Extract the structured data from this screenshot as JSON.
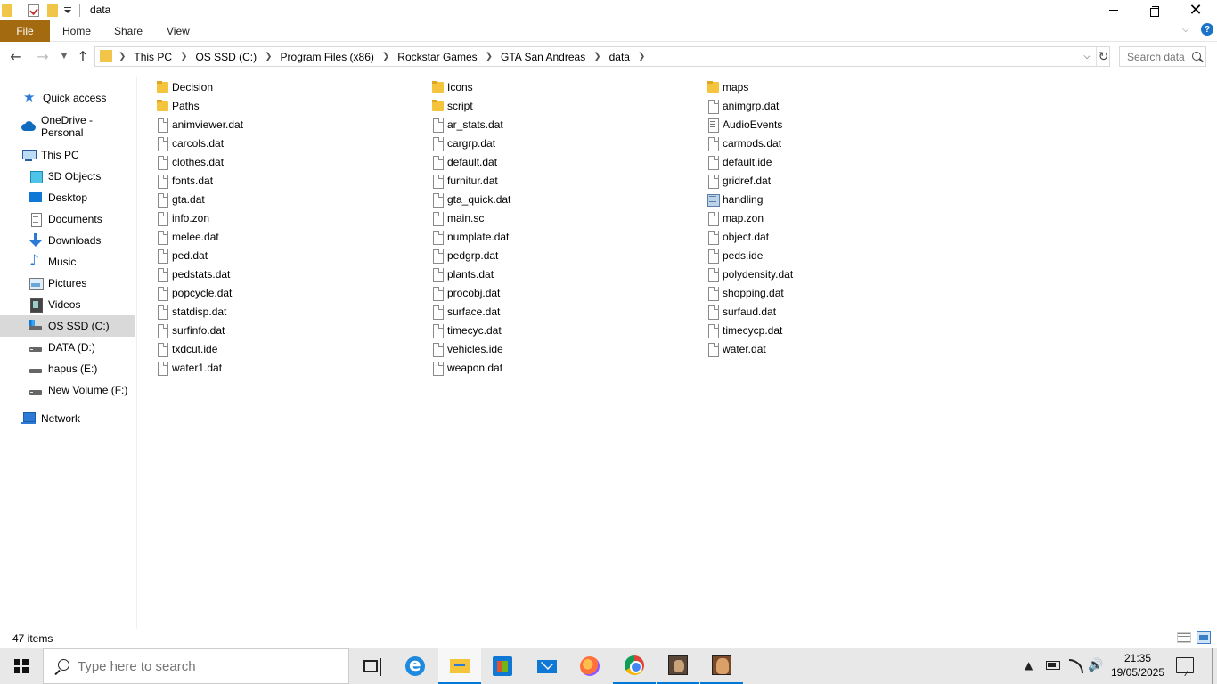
{
  "window": {
    "title": "data",
    "controls": {
      "minimize": "–",
      "maximize": "restore",
      "close": "✕"
    }
  },
  "ribbon": {
    "tabs": {
      "file": "File",
      "home": "Home",
      "share": "Share",
      "view": "View"
    }
  },
  "navigation": {
    "breadcrumb": [
      "This PC",
      "OS SSD (C:)",
      "Program Files (x86)",
      "Rockstar Games",
      "GTA San Andreas",
      "data"
    ],
    "search_placeholder": "Search data"
  },
  "sidebar": {
    "items": [
      {
        "label": "Quick access",
        "icon": "star-icon"
      },
      {
        "label": "OneDrive - Personal",
        "icon": "cloud-icon"
      },
      {
        "label": "This PC",
        "icon": "computer-icon"
      },
      {
        "label": "3D Objects",
        "icon": "cube-icon"
      },
      {
        "label": "Desktop",
        "icon": "desktop-icon"
      },
      {
        "label": "Documents",
        "icon": "documents-icon"
      },
      {
        "label": "Downloads",
        "icon": "download-icon"
      },
      {
        "label": "Music",
        "icon": "music-icon"
      },
      {
        "label": "Pictures",
        "icon": "pictures-icon"
      },
      {
        "label": "Videos",
        "icon": "videos-icon"
      },
      {
        "label": "OS SSD (C:)",
        "icon": "ssd-drive-icon",
        "selected": true
      },
      {
        "label": "DATA (D:)",
        "icon": "drive-icon"
      },
      {
        "label": "hapus (E:)",
        "icon": "drive-icon"
      },
      {
        "label": "New Volume (F:)",
        "icon": "drive-icon"
      },
      {
        "label": "Network",
        "icon": "network-icon"
      }
    ]
  },
  "files": {
    "column1": [
      {
        "name": "Decision",
        "type": "folder"
      },
      {
        "name": "Paths",
        "type": "folder"
      },
      {
        "name": "animviewer.dat",
        "type": "doc"
      },
      {
        "name": "carcols.dat",
        "type": "doc"
      },
      {
        "name": "clothes.dat",
        "type": "doc"
      },
      {
        "name": "fonts.dat",
        "type": "doc"
      },
      {
        "name": "gta.dat",
        "type": "doc"
      },
      {
        "name": "info.zon",
        "type": "doc"
      },
      {
        "name": "melee.dat",
        "type": "doc"
      },
      {
        "name": "ped.dat",
        "type": "doc"
      },
      {
        "name": "pedstats.dat",
        "type": "doc"
      },
      {
        "name": "popcycle.dat",
        "type": "doc"
      },
      {
        "name": "statdisp.dat",
        "type": "doc"
      },
      {
        "name": "surfinfo.dat",
        "type": "doc"
      },
      {
        "name": "txdcut.ide",
        "type": "doc"
      },
      {
        "name": "water1.dat",
        "type": "doc"
      }
    ],
    "column2": [
      {
        "name": "Icons",
        "type": "folder"
      },
      {
        "name": "script",
        "type": "folder"
      },
      {
        "name": "ar_stats.dat",
        "type": "doc"
      },
      {
        "name": "cargrp.dat",
        "type": "doc"
      },
      {
        "name": "default.dat",
        "type": "doc"
      },
      {
        "name": "furnitur.dat",
        "type": "doc"
      },
      {
        "name": "gta_quick.dat",
        "type": "doc"
      },
      {
        "name": "main.sc",
        "type": "doc"
      },
      {
        "name": "numplate.dat",
        "type": "doc"
      },
      {
        "name": "pedgrp.dat",
        "type": "doc"
      },
      {
        "name": "plants.dat",
        "type": "doc"
      },
      {
        "name": "procobj.dat",
        "type": "doc"
      },
      {
        "name": "surface.dat",
        "type": "doc"
      },
      {
        "name": "timecyc.dat",
        "type": "doc"
      },
      {
        "name": "vehicles.ide",
        "type": "doc"
      },
      {
        "name": "weapon.dat",
        "type": "doc"
      }
    ],
    "column3": [
      {
        "name": "maps",
        "type": "folder"
      },
      {
        "name": "animgrp.dat",
        "type": "doc"
      },
      {
        "name": "AudioEvents",
        "type": "text"
      },
      {
        "name": "carmods.dat",
        "type": "doc"
      },
      {
        "name": "default.ide",
        "type": "doc"
      },
      {
        "name": "gridref.dat",
        "type": "doc"
      },
      {
        "name": "handling",
        "type": "cfg"
      },
      {
        "name": "map.zon",
        "type": "doc"
      },
      {
        "name": "object.dat",
        "type": "doc"
      },
      {
        "name": "peds.ide",
        "type": "doc"
      },
      {
        "name": "polydensity.dat",
        "type": "doc"
      },
      {
        "name": "shopping.dat",
        "type": "doc"
      },
      {
        "name": "surfaud.dat",
        "type": "doc"
      },
      {
        "name": "timecycp.dat",
        "type": "doc"
      },
      {
        "name": "water.dat",
        "type": "doc"
      }
    ]
  },
  "status": {
    "item_count": "47 items"
  },
  "taskbar": {
    "search_placeholder": "Type here to search",
    "time": "21:35",
    "date": "19/05/2025"
  },
  "colors": {
    "file_tab": "#a36a0f",
    "selected_item": "#d9d9d9",
    "folder": "#f4c43d",
    "taskbar": "#e8e8e8",
    "accent": "#0078d7"
  }
}
